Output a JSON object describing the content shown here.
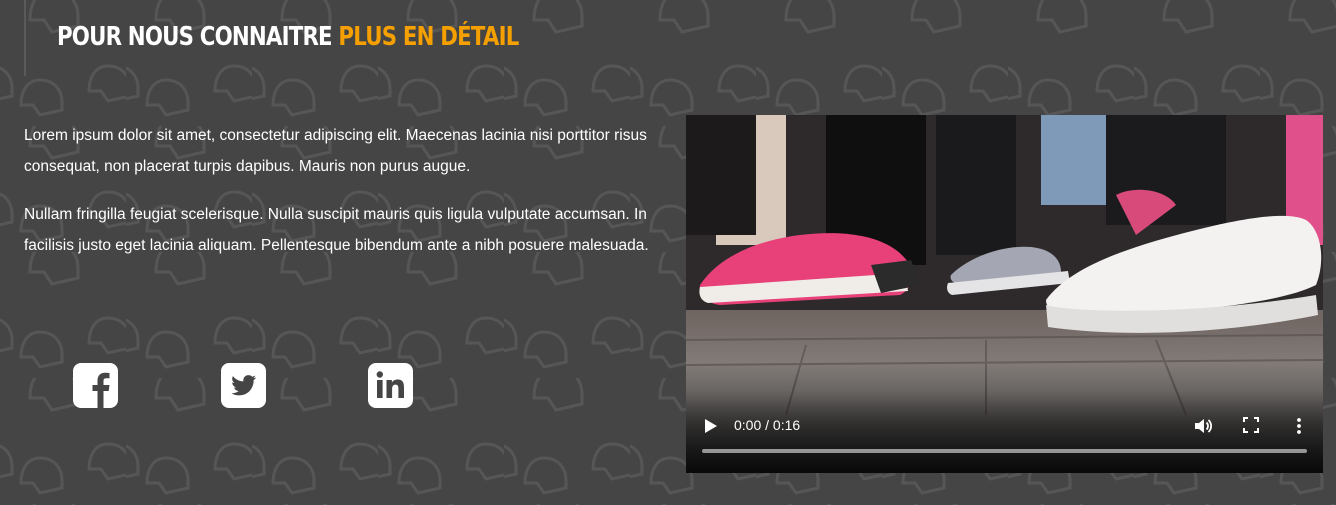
{
  "section": {
    "title_main": "POUR NOUS CONNAITRE",
    "title_accent": "PLUS EN DÉTAIL",
    "accent_color": "#f5a000"
  },
  "content": {
    "paragraphs": [
      "Lorem ipsum dolor sit amet, consectetur adipiscing elit. Maecenas lacinia nisi porttitor risus consequat, non placerat turpis dapibus. Mauris non purus augue.",
      "Nullam fringilla feugiat scelerisque. Nulla suscipit mauris quis ligula vulputate accumsan. In facilisis justo eget lacinia aliquam. Pellentesque bibendum ante a nibh posuere malesuada."
    ]
  },
  "social": [
    {
      "name": "facebook",
      "icon": "facebook-icon"
    },
    {
      "name": "twitter",
      "icon": "twitter-icon"
    },
    {
      "name": "linkedin",
      "icon": "linkedin-icon"
    }
  ],
  "video": {
    "time_display": "0:00 / 0:16",
    "progress": 0,
    "icons": [
      "play-icon",
      "volume-icon",
      "fullscreen-icon",
      "more-options-icon"
    ]
  }
}
